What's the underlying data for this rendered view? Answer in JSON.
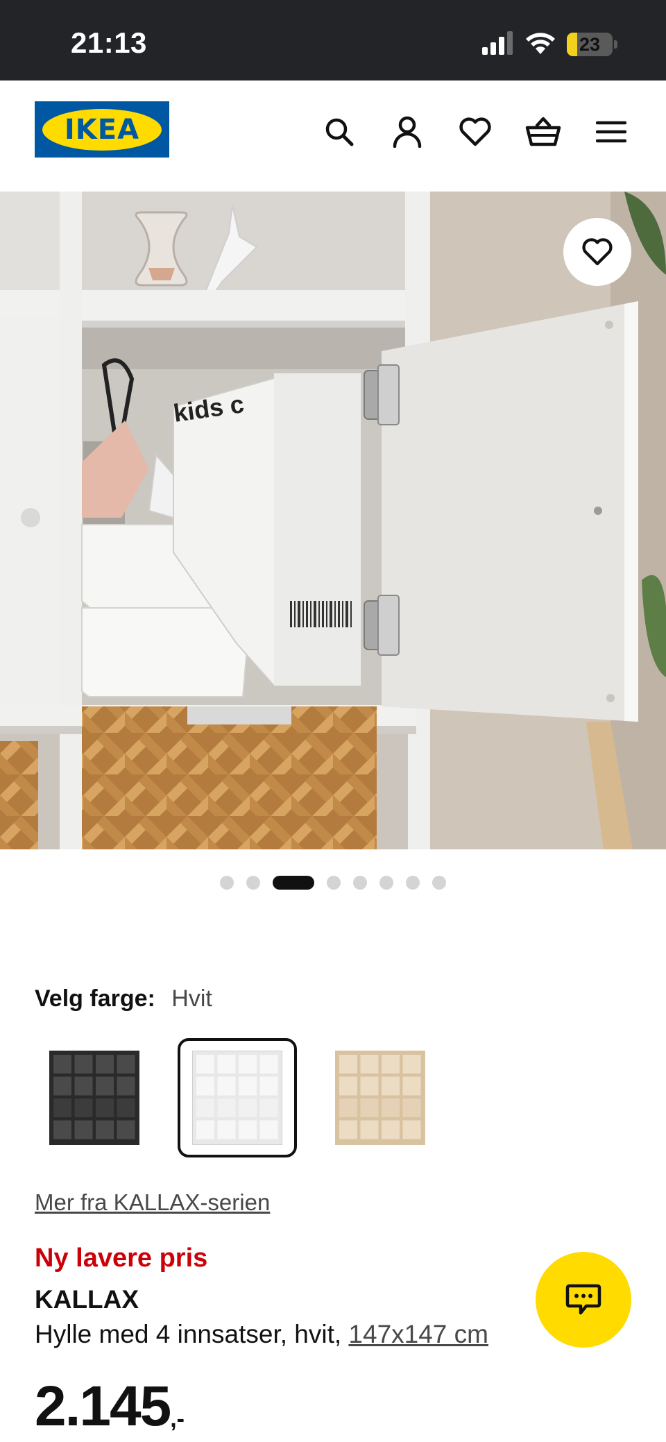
{
  "status_bar": {
    "time": "21:13",
    "battery": "23",
    "battery_level": 0.23
  },
  "header": {
    "logo_text": "IKEA",
    "icons": [
      "search-icon",
      "account-icon",
      "favorites-icon",
      "cart-icon",
      "menu-icon"
    ]
  },
  "gallery": {
    "image_count": 8,
    "active_index": 2,
    "image_text": "kids c"
  },
  "color_picker": {
    "label": "Velg farge:",
    "selected": "Hvit",
    "options": [
      "black-brown",
      "white",
      "white-stained-oak"
    ]
  },
  "series_link": "Mer fra KALLAX-serien",
  "product": {
    "badge": "Ny lavere pris",
    "name": "KALLAX",
    "description": "Hylle med 4 innsatser, hvit,",
    "dimensions": "147x147 cm",
    "price_integer": "2.145",
    "price_decimal": ",-"
  },
  "colors": {
    "ikea_blue": "#0058a3",
    "ikea_yellow": "#ffdb00",
    "price_red": "#cc0008",
    "status_bar": "#222428"
  }
}
